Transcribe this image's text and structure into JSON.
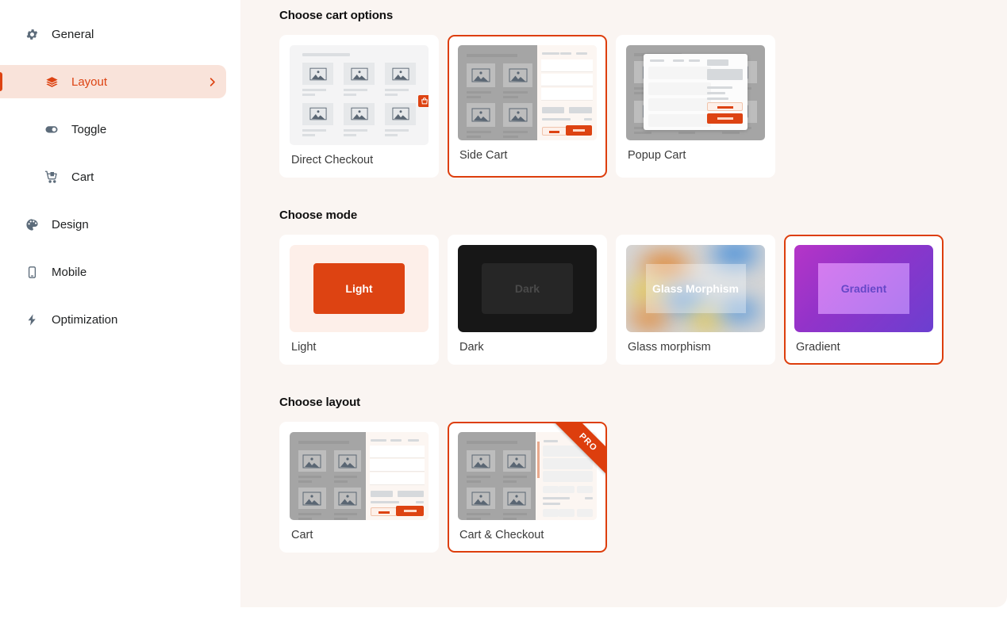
{
  "sidebar": {
    "items": [
      {
        "label": "General",
        "icon": "gear-icon",
        "level": "top",
        "active": false
      },
      {
        "label": "Layout",
        "icon": "layers-icon",
        "level": "top",
        "active": true,
        "chevron": "chevron-right-icon"
      },
      {
        "label": "Toggle",
        "icon": "toggle-icon",
        "level": "sub",
        "active": false
      },
      {
        "label": "Cart",
        "icon": "shopping-cart-icon",
        "level": "sub",
        "active": false
      },
      {
        "label": "Design",
        "icon": "palette-icon",
        "level": "top",
        "active": false
      },
      {
        "label": "Mobile",
        "icon": "mobile-phone-icon",
        "level": "top",
        "active": false
      },
      {
        "label": "Optimization",
        "icon": "lightning-bolt-icon",
        "level": "top",
        "active": false
      }
    ]
  },
  "sections": {
    "cart_options": {
      "title": "Choose cart options",
      "cards": [
        {
          "label": "Direct Checkout",
          "selected": false
        },
        {
          "label": "Side Cart",
          "selected": true
        },
        {
          "label": "Popup Cart",
          "selected": false
        }
      ]
    },
    "mode": {
      "title": "Choose mode",
      "cards": [
        {
          "label": "Light",
          "preview_text": "Light",
          "selected": false
        },
        {
          "label": "Dark",
          "preview_text": "Dark",
          "selected": false
        },
        {
          "label": "Glass morphism",
          "preview_text": "Glass Morphism",
          "selected": false
        },
        {
          "label": "Gradient",
          "preview_text": "Gradient",
          "selected": true
        }
      ]
    },
    "layout": {
      "title": "Choose layout",
      "cards": [
        {
          "label": "Cart",
          "selected": false,
          "badge": ""
        },
        {
          "label": "Cart & Checkout",
          "selected": true,
          "badge": "PRO"
        }
      ]
    }
  },
  "colors": {
    "accent": "#DD4312",
    "selected_border": "#DD3E0D",
    "active_nav_bg": "#F9E3DA",
    "content_bg": "#FAF5F2",
    "card_bg": "#FFFFFF",
    "dark_swatch": "#171717",
    "gradient_from": "#B535C8",
    "gradient_to": "#6B3FD0"
  }
}
